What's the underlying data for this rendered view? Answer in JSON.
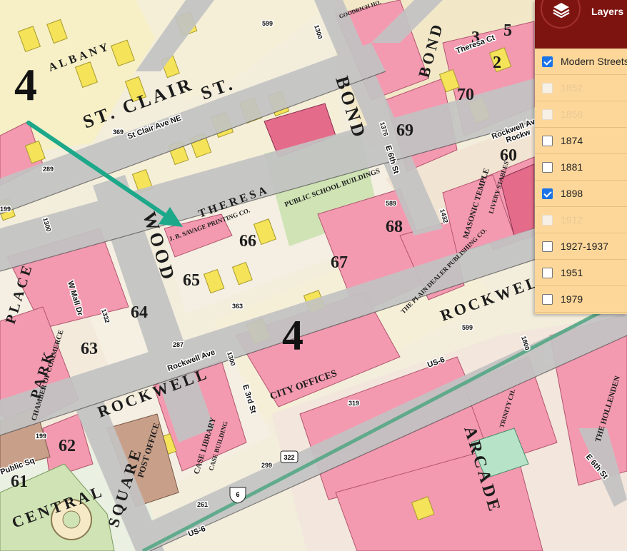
{
  "map": {
    "ward_numbers": [
      "4",
      "4"
    ],
    "block_numbers": [
      "70",
      "69",
      "68",
      "67",
      "66",
      "65",
      "64",
      "63",
      "62",
      "61",
      "60",
      "2",
      "3",
      "5"
    ],
    "street_names_historic": [
      "ST. CLAIR",
      "ALBANY",
      "ST.",
      "THERESA",
      "WOOD",
      "BOND",
      "ROCKWELL",
      "ROCKWELL",
      "PARK",
      "PLACE",
      "ARCADE",
      "SQUARE",
      "CENTRAL",
      "BOND"
    ],
    "building_labels": [
      "PUBLIC SCHOOL BUILDINGS",
      "J. B. SAVAGE PRINTING CO.",
      "MASONIC TEMPLE",
      "LIVERY STABLES",
      "THE PLAIN DEALER PUBLISHING CO.",
      "CITY OFFICES",
      "POST OFFICE",
      "CASE LIBRARY",
      "CASE BUILDING",
      "CHAMBER OF COMMERCE",
      "THE HOLLENDEN",
      "GOODRICH HO.",
      "TRINITY CH."
    ],
    "modern_street_labels": [
      "St Clair Ave NE",
      "Theresa Ct",
      "Rockwell Ave",
      "Rockwell Ave",
      "E 6th St",
      "E 3rd St",
      "W Mall Dr",
      "Public Sq",
      "US-6",
      "US-6",
      "US-6",
      "E 6th St",
      "Rockw"
    ],
    "road_numbers": [
      "599",
      "1300",
      "369",
      "289",
      "199",
      "1300",
      "1376",
      "589",
      "1432",
      "599",
      "287",
      "1332",
      "363",
      "1300",
      "319",
      "299",
      "261",
      "199",
      "1800"
    ],
    "shields": [
      "322",
      "6"
    ],
    "colors": {
      "brick": "#f39ab0",
      "frame": "#f5e35a",
      "stone": "#e46b8a",
      "street": "#bcbcbc",
      "lot": "#f5f0e0",
      "green_space": "#cfe3b4",
      "arrow": "#1da88a"
    }
  },
  "layers": {
    "title": "Layers",
    "items": [
      {
        "label": "Modern Streets",
        "checked": true,
        "enabled": true
      },
      {
        "label": "1852",
        "checked": false,
        "enabled": false
      },
      {
        "label": "1858",
        "checked": false,
        "enabled": false
      },
      {
        "label": "1874",
        "checked": false,
        "enabled": true
      },
      {
        "label": "1881",
        "checked": false,
        "enabled": true
      },
      {
        "label": "1898",
        "checked": true,
        "enabled": true
      },
      {
        "label": "1912",
        "checked": false,
        "enabled": false
      },
      {
        "label": "1927-1937",
        "checked": false,
        "enabled": true
      },
      {
        "label": "1951",
        "checked": false,
        "enabled": true
      },
      {
        "label": "1979",
        "checked": false,
        "enabled": true
      }
    ]
  }
}
